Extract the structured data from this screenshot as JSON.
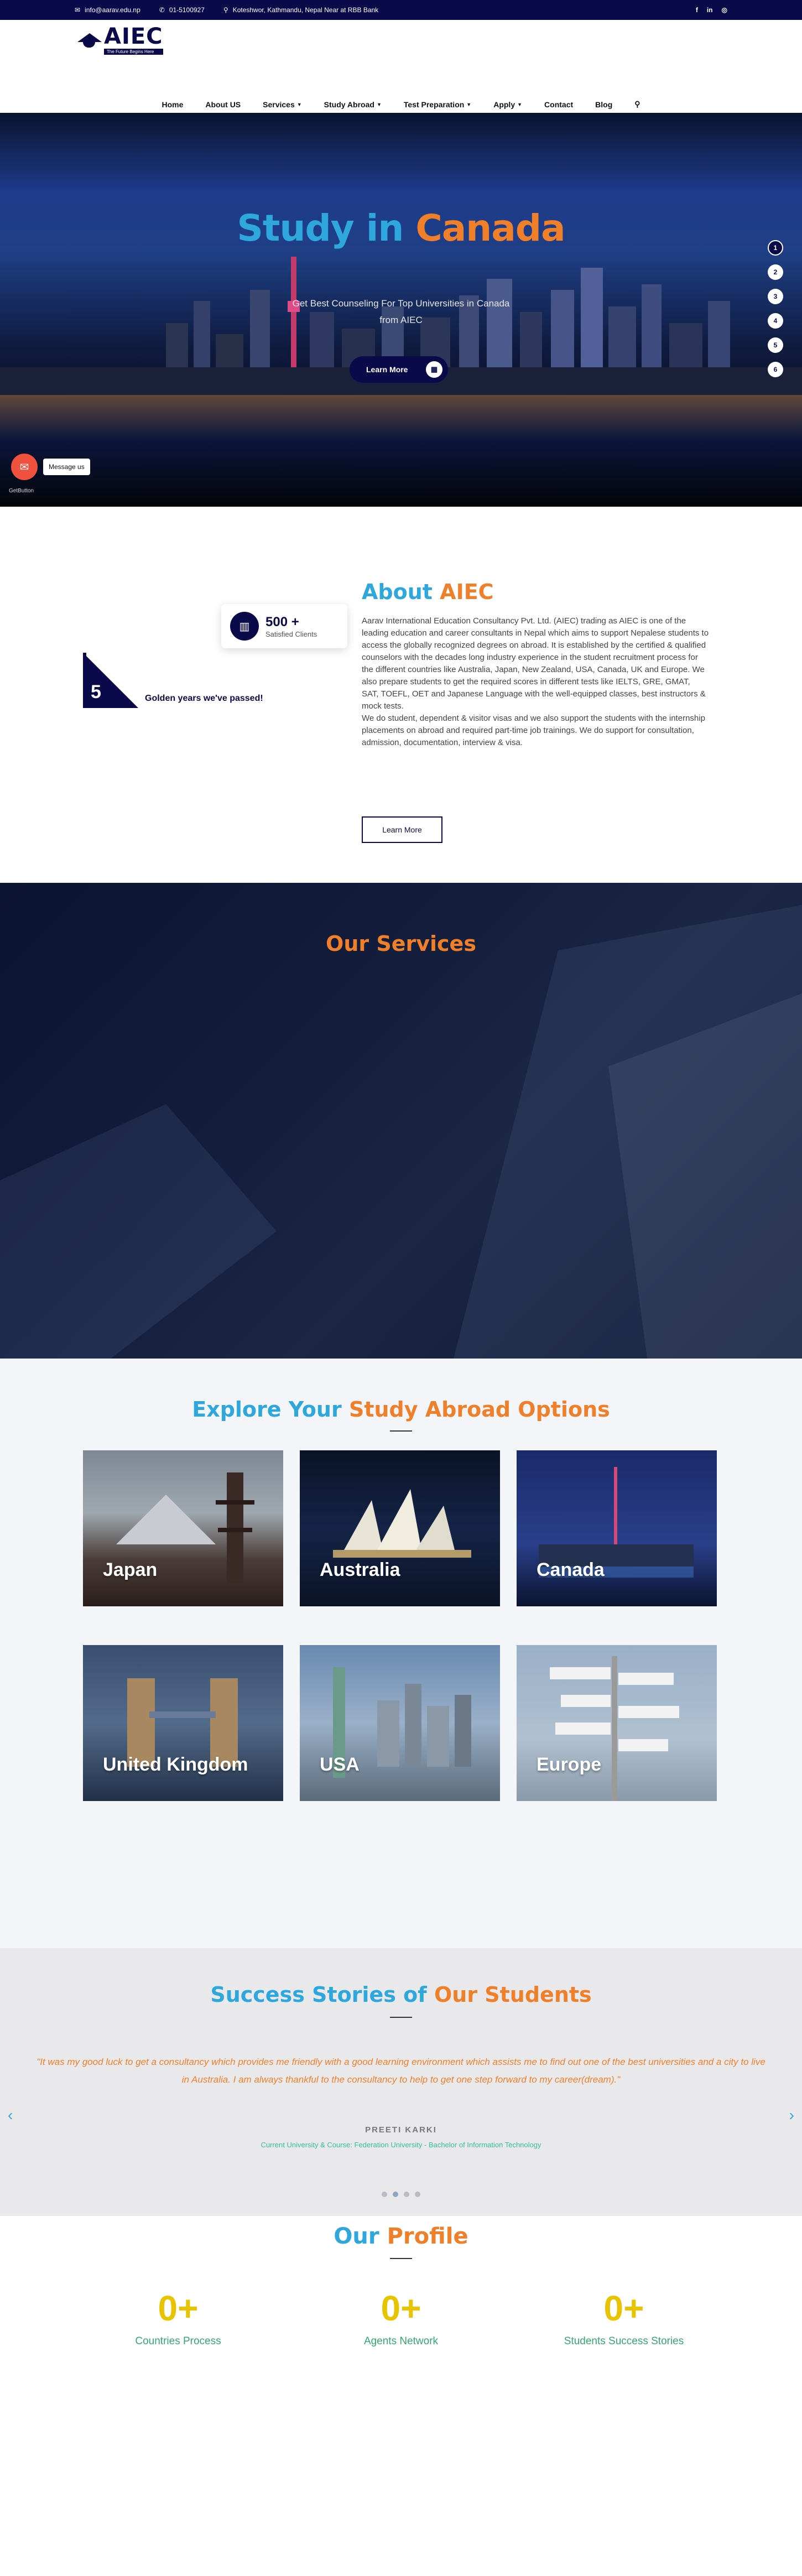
{
  "topbar": {
    "email": "info@aarav.edu.np",
    "phone": "01-5100927",
    "address": "Koteshwor, Kathmandu, Nepal Near at RBB Bank",
    "socials": [
      "f",
      "in",
      "◎"
    ]
  },
  "brand": {
    "name": "AIEC",
    "tagline": "The Future Begins Here"
  },
  "nav": {
    "items": [
      "Home",
      "About US",
      "Services",
      "Study Abroad",
      "Test Preparation",
      "Apply",
      "Contact",
      "Blog"
    ],
    "dropdowns": [
      false,
      false,
      true,
      true,
      true,
      true,
      false,
      false
    ]
  },
  "hero": {
    "title_part1": "Study in",
    "title_part2": "Canada",
    "subtitle_line1": "Get Best Counseling For Top Universities in Canada",
    "subtitle_line2": "from AIEC",
    "button_label": "Learn More",
    "slides": [
      "1",
      "2",
      "3",
      "4",
      "5",
      "6"
    ],
    "active_slide": 1
  },
  "messenger": {
    "label": "Message us",
    "powered": "GetButton"
  },
  "about": {
    "clients_count": "500 +",
    "clients_label": "Satisfied Clients",
    "years": "5",
    "years_label": "Golden years we've passed!",
    "title_part1": "About",
    "title_part2": "AIEC",
    "paragraph1": "Aarav International Education Consultancy Pvt. Ltd. (AIEC) trading as AIEC is one of the leading education and career consultants in Nepal which aims to support Nepalese students to access the globally recognized degrees on abroad. It is established by the certified & qualified counselors with the decades long industry experience in the student recruitment process for the different countries like Australia, Japan, New Zealand, USA, Canada, UK and Europe. We also prepare students to get the required scores in different tests like IELTS, GRE, GMAT, SAT, TOEFL, OET and Japanese Language with the well-equipped classes, best instructors & mock tests.",
    "paragraph2": "We do student, dependent & visitor visas and we also support the students with the internship placements on abroad and required part-time job trainings. We do support for consultation, admission, documentation, interview & visa.",
    "button_label": "Learn More"
  },
  "services": {
    "title": "Our Services"
  },
  "study_abroad": {
    "title_part1": "Explore Your",
    "title_part2": "Study Abroad Options",
    "destinations": [
      "Japan",
      "Australia",
      "Canada",
      "United Kingdom",
      "USA",
      "Europe"
    ]
  },
  "testimonials": {
    "title_part1": "Success Stories of",
    "title_part2": "Our Students",
    "quote": "\"It was my good luck to get a consultancy which provides me friendly with a good learning environment which assists me to find out one of the best universities and a city to live in Australia. I am always thankful to the consultancy to help to get one step forward to my career(dream).\"",
    "name": "PREETI KARKI",
    "details": "Current University & Course: Federation University - Bachelor of Information Technology",
    "pages": 4,
    "active_page": 2
  },
  "profile": {
    "title_part1": "Our",
    "title_part2": "Profile",
    "stats": [
      {
        "value": "0+",
        "label": "Countries Process"
      },
      {
        "value": "0+",
        "label": "Agents Network"
      },
      {
        "value": "0+",
        "label": "Students Success Stories"
      }
    ]
  },
  "colors": {
    "navy": "#0a0a4a",
    "blue_accent": "#2da7dc",
    "orange_accent": "#f07f2a",
    "stat_yellow": "#e8c400",
    "stat_green": "#34a870"
  }
}
